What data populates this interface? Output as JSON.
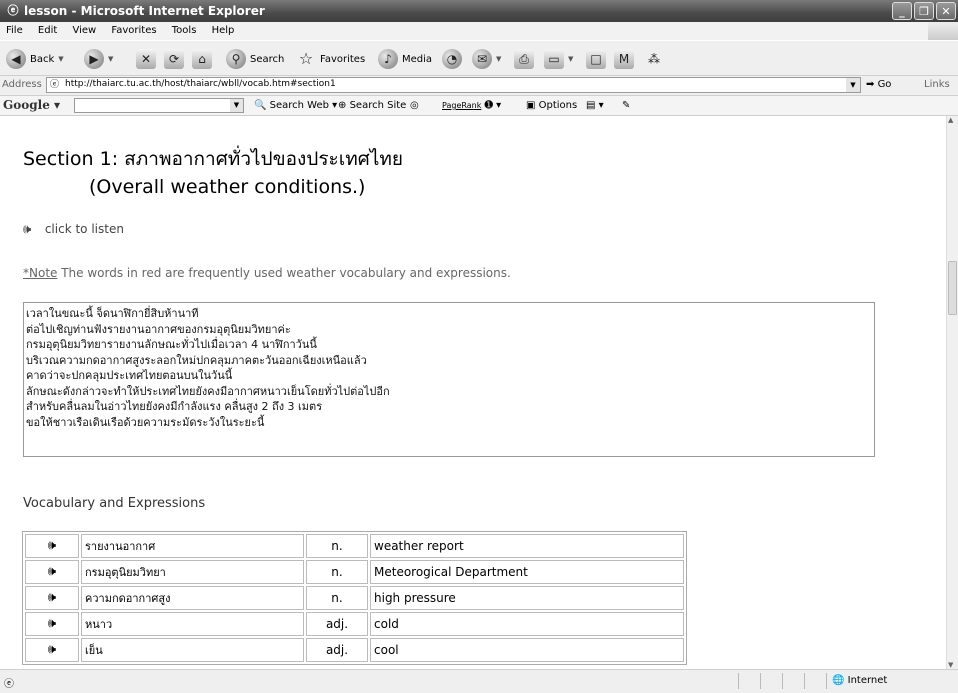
{
  "window": {
    "title": "lesson - Microsoft Internet Explorer"
  },
  "menu": [
    "File",
    "Edit",
    "View",
    "Favorites",
    "Tools",
    "Help"
  ],
  "toolbar": {
    "back": "Back",
    "search": "Search",
    "favorites": "Favorites",
    "media": "Media"
  },
  "address": {
    "label": "Address",
    "url": "http://thaiarc.tu.ac.th/host/thaiarc/wbll/vocab.htm#section1",
    "go": "Go",
    "links": "Links"
  },
  "google": {
    "logo": "Google",
    "search_web": "Search Web",
    "search_site": "Search Site",
    "pagerank": "PageRank",
    "options": "Options"
  },
  "page": {
    "section_title": "Section 1: สภาพอากาศทั่วไปของประเทศไทย",
    "section_subtitle": "(Overall weather conditions.)",
    "listen": "click to listen",
    "note_label": "*Note",
    "note_text": " The words in red are frequently used weather vocabulary and expressions.",
    "lines": [
      "เวลาในขณะนี้ จ็ดนาฬิกายี่สิบห้านาที",
      "ต่อไปเชิญท่านฟังรายงานอากาศของกรมอุตุนิยมวิทยาค่ะ",
      "กรมอุตุนิยมวิทยารายงานลักษณะทั่วไปเมื่อเวลา 4 นาฬิกาวันนี้",
      "บริเวณความกดอากาศสูงระลอกใหม่ปกคลุมภาคตะวันออกเฉียงเหนือแล้ว",
      "คาดว่าจะปกคลุมประเทศไทยตอนบนในวันนี้",
      "ลักษณะดังกล่าวจะทำให้ประเทศไทยยังคงมีอากาศหนาวเย็นโดยทั่วไปต่อไปอีก",
      "สำหรับคลื่นลมในอ่าวไทยยังคงมีกำลังแรง คลื่นสูง 2 ถึง 3 เมตร",
      "ขอให้ชาวเรือเดินเรือด้วยความระมัดระวังในระยะนี้"
    ],
    "vocab_heading": "Vocabulary and Expressions",
    "vocab": [
      {
        "thai": "รายงานอากาศ",
        "pos": "n.",
        "en": "weather report"
      },
      {
        "thai": "กรมอุตุนิยมวิทยา",
        "pos": "n.",
        "en": "Meteorogical Department"
      },
      {
        "thai": "ความกดอากาศสูง",
        "pos": "n.",
        "en": "high pressure"
      },
      {
        "thai": "หนาว",
        "pos": "adj.",
        "en": "cold"
      },
      {
        "thai": "เย็น",
        "pos": "adj.",
        "en": "cool"
      }
    ]
  },
  "status": {
    "zone": "Internet"
  },
  "icons": {
    "speaker": "speaker-icon",
    "ie": "ie-icon",
    "globe": "globe-icon"
  }
}
